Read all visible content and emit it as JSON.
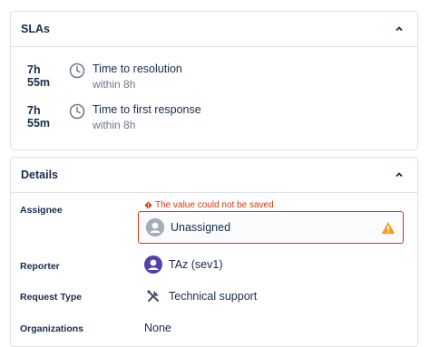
{
  "slas": {
    "title": "SLAs",
    "items": [
      {
        "time": "7h 55m",
        "name": "Time to resolution",
        "target": "within 8h"
      },
      {
        "time": "7h 55m",
        "name": "Time to first response",
        "target": "within 8h"
      }
    ]
  },
  "details": {
    "title": "Details",
    "assignee": {
      "label": "Assignee",
      "error": "The value could not be saved",
      "value": "Unassigned"
    },
    "reporter": {
      "label": "Reporter",
      "value": "TAz (sev1)"
    },
    "request_type": {
      "label": "Request Type",
      "value": "Technical support"
    },
    "organizations": {
      "label": "Organizations",
      "value": "None"
    }
  },
  "colors": {
    "error": "#de350b",
    "warning": "#ff991f",
    "reporter_avatar": "#5243aa",
    "text": "#172b4d",
    "subtle": "#6b778c"
  },
  "icons": {
    "collapse": "chevron-up-icon",
    "sla_clock": "clock-icon",
    "error": "error-icon",
    "warning": "warning-icon",
    "assignee_avatar": "user-avatar-icon",
    "request_type": "tools-icon"
  }
}
